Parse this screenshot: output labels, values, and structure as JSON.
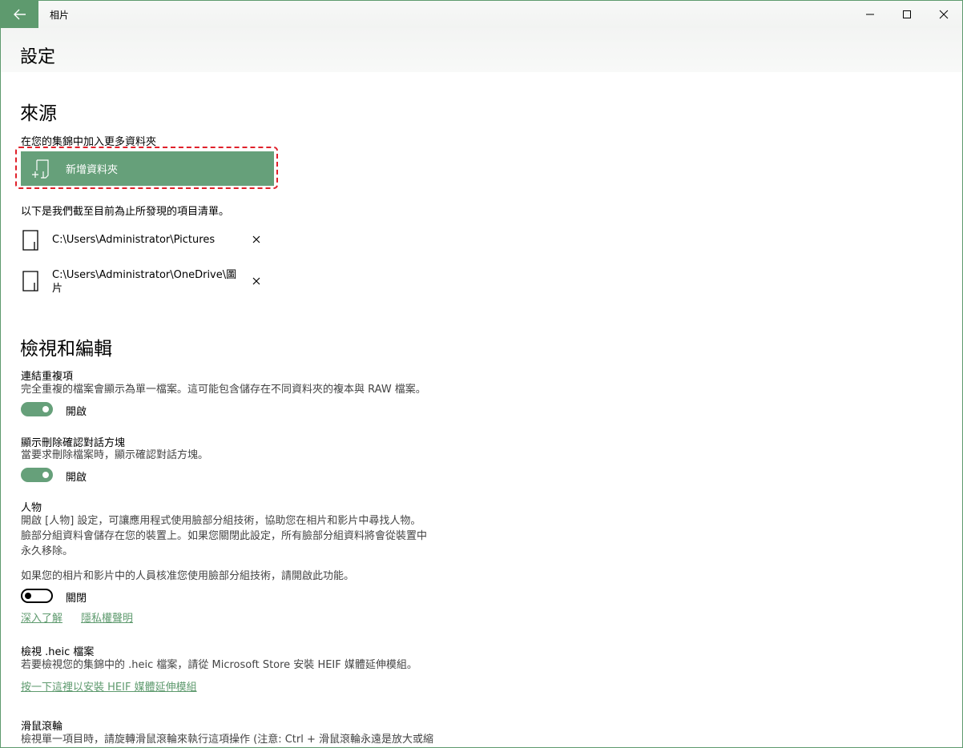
{
  "window": {
    "title": "相片"
  },
  "page": {
    "title": "設定"
  },
  "sources": {
    "heading": "來源",
    "add_prompt": "在您的集錦中加入更多資料夾",
    "add_button_label": "新增資料夾",
    "list_intro": "以下是我們截至目前為止所發現的項目清單。",
    "folders": [
      {
        "path": "C:\\Users\\Administrator\\Pictures"
      },
      {
        "path": "C:\\Users\\Administrator\\OneDrive\\圖片"
      }
    ]
  },
  "view_edit": {
    "heading": "檢視和編輯",
    "linked_duplicates": {
      "title": "連結重複項",
      "description": "完全重複的檔案會顯示為單一檔案。這可能包含儲存在不同資料夾的複本與 RAW 檔案。",
      "state_label": "開啟",
      "on": true
    },
    "delete_confirm": {
      "title": "顯示刪除確認對話方塊",
      "description": "當要求刪除檔案時，顯示確認對話方塊。",
      "state_label": "開啟",
      "on": true
    },
    "people": {
      "title": "人物",
      "description_lines": [
        "開啟 [人物] 設定，可讓應用程式使用臉部分組技術，協助您在相片和影片中尋找人物。",
        "臉部分組資料會儲存在您的裝置上。如果您關閉此設定，所有臉部分組資料將會從裝置中",
        "永久移除。"
      ],
      "consent_note": "如果您的相片和影片中的人員核准您使用臉部分組技術，請開啟此功能。",
      "state_label": "關閉",
      "on": false,
      "learn_more_link": "深入了解",
      "privacy_link": "隱私權聲明"
    },
    "heic": {
      "title": "檢視 .heic 檔案",
      "description": "若要檢視您的集錦中的 .heic 檔案，請從 Microsoft Store 安裝 HEIF 媒體延伸模組。",
      "install_link": "按一下這裡以安裝 HEIF 媒體延伸模組"
    },
    "mouse_wheel": {
      "title": "滑鼠滾輪",
      "description": "檢視單一項目時，請旋轉滑鼠滾輪來執行這項操作 (注意: Ctrl + 滑鼠滾輪永遠是放大或縮"
    }
  },
  "icons": {
    "back": "back-arrow-icon",
    "minimize": "minimize-icon",
    "maximize": "maximize-icon",
    "close": "close-icon",
    "add_folder": "add-folder-icon",
    "folder": "folder-icon",
    "remove": "remove-x-icon"
  },
  "colors": {
    "accent": "#66a07a",
    "link": "#5e9a6e",
    "highlight": "#e0202a"
  }
}
